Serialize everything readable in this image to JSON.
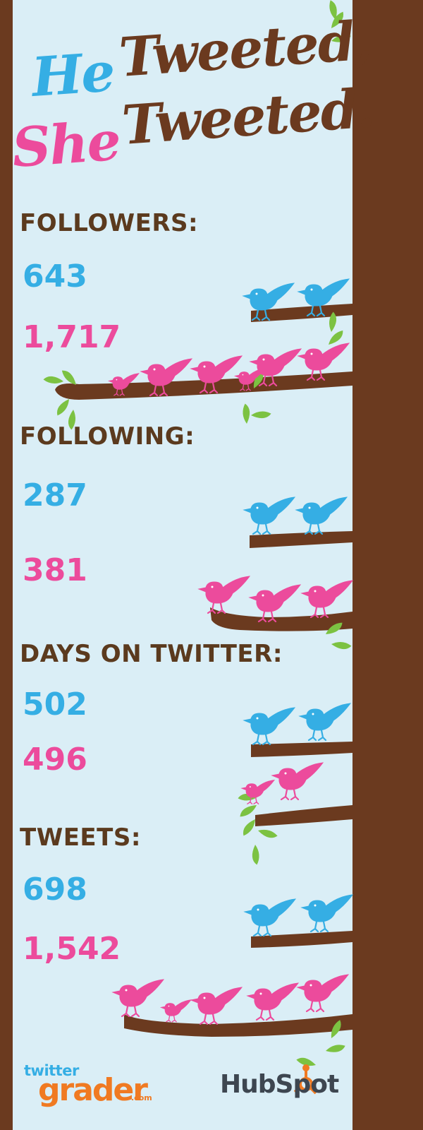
{
  "title": {
    "he": "He",
    "tweeted_1": "Tweeted,",
    "she": "She",
    "tweeted_2": "Tweeted."
  },
  "stats": [
    {
      "label": "FOLLOWERS:",
      "he": "643",
      "she": "1,717"
    },
    {
      "label": "FOLLOWING:",
      "he": "287",
      "she": "381"
    },
    {
      "label": "DAYS ON TWITTER:",
      "he": "502",
      "she": "496"
    },
    {
      "label": "TWEETS:",
      "he": "698",
      "she": "1,542"
    }
  ],
  "logos": {
    "twitter_grader_top": "twitter",
    "twitter_grader_main": "grader",
    "twitter_grader_suffix": ".com",
    "hubspot": "HubSpot"
  },
  "colors": {
    "sky": "#daeef6",
    "trunk": "#6b3a1f",
    "he_blue": "#35aee4",
    "she_pink": "#ec4b9c",
    "leaf_green": "#7cc242",
    "label_brown": "#5b3a1e",
    "grader_orange": "#f07a22",
    "hubspot_gray": "#3d4650"
  },
  "icons": [
    "bird-icon",
    "leaf-icon",
    "tree-branch"
  ]
}
